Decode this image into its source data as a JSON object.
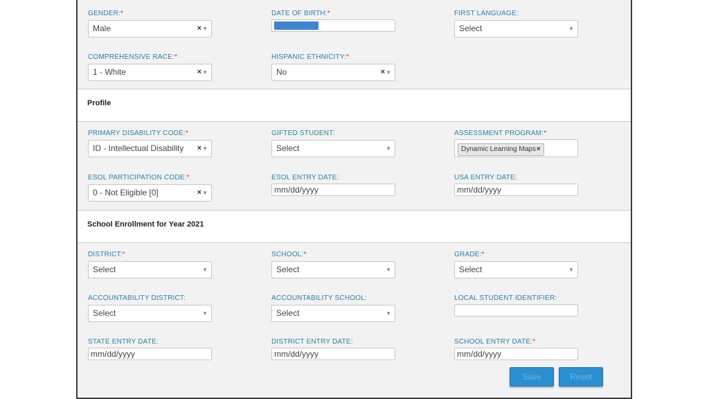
{
  "demographics": {
    "gender": {
      "label": "GENDER:",
      "required": "*",
      "value": "Male"
    },
    "dob": {
      "label": "DATE OF BIRTH:",
      "required": "*"
    },
    "first_language": {
      "label": "FIRST LANGUAGE:",
      "value": "Select"
    },
    "race": {
      "label": "COMPREHENSIVE RACE:",
      "required": "*",
      "value": "1 - White"
    },
    "hispanic": {
      "label": "HISPANIC ETHNICITY:",
      "required": "*",
      "value": "No"
    }
  },
  "profile": {
    "title": "Profile",
    "disability": {
      "label": "PRIMARY DISABILITY CODE:",
      "required": "*",
      "value": "ID - Intellectual Disability"
    },
    "gifted": {
      "label": "GIFTED STUDENT:",
      "value": "Select"
    },
    "assessment": {
      "label": "ASSESSMENT PROGRAM:",
      "required": "*",
      "tag": "Dynamic Learning Maps"
    },
    "esol_code": {
      "label": "ESOL PARTICIPATION CODE:",
      "required": "*",
      "value": "0 - Not Eligible [0]"
    },
    "esol_date": {
      "label": "ESOL ENTRY DATE:",
      "value": "mm/dd/yyyy"
    },
    "usa_date": {
      "label": "USA ENTRY DATE:",
      "value": "mm/dd/yyyy"
    }
  },
  "enrollment": {
    "title": "School Enrollment for Year 2021",
    "district": {
      "label": "DISTRICT:",
      "required": "*",
      "value": "Select"
    },
    "school": {
      "label": "SCHOOL:",
      "required": "*",
      "value": "Select"
    },
    "grade": {
      "label": "GRADE:",
      "required": "*",
      "value": "Select"
    },
    "acc_district": {
      "label": "ACCOUNTABILITY DISTRICT:",
      "value": "Select"
    },
    "acc_school": {
      "label": "ACCOUNTABILITY SCHOOL:",
      "value": "Select"
    },
    "local_id": {
      "label": "LOCAL STUDENT IDENTIFIER:",
      "value": ""
    },
    "state_date": {
      "label": "STATE ENTRY DATE:",
      "value": "mm/dd/yyyy"
    },
    "district_date": {
      "label": "DISTRICT ENTRY DATE:",
      "value": "mm/dd/yyyy"
    },
    "school_date": {
      "label": "SCHOOL ENTRY DATE:",
      "required": "*",
      "value": "mm/dd/yyyy"
    }
  },
  "actions": {
    "save_label": "Save",
    "reset_label": "Reset"
  },
  "icons": {
    "clear": "×",
    "arrow": "▼",
    "tag_remove": "×"
  },
  "colors": {
    "label": "#2b7fa5",
    "required": "#d0342c",
    "button": "#2a8fd0"
  }
}
